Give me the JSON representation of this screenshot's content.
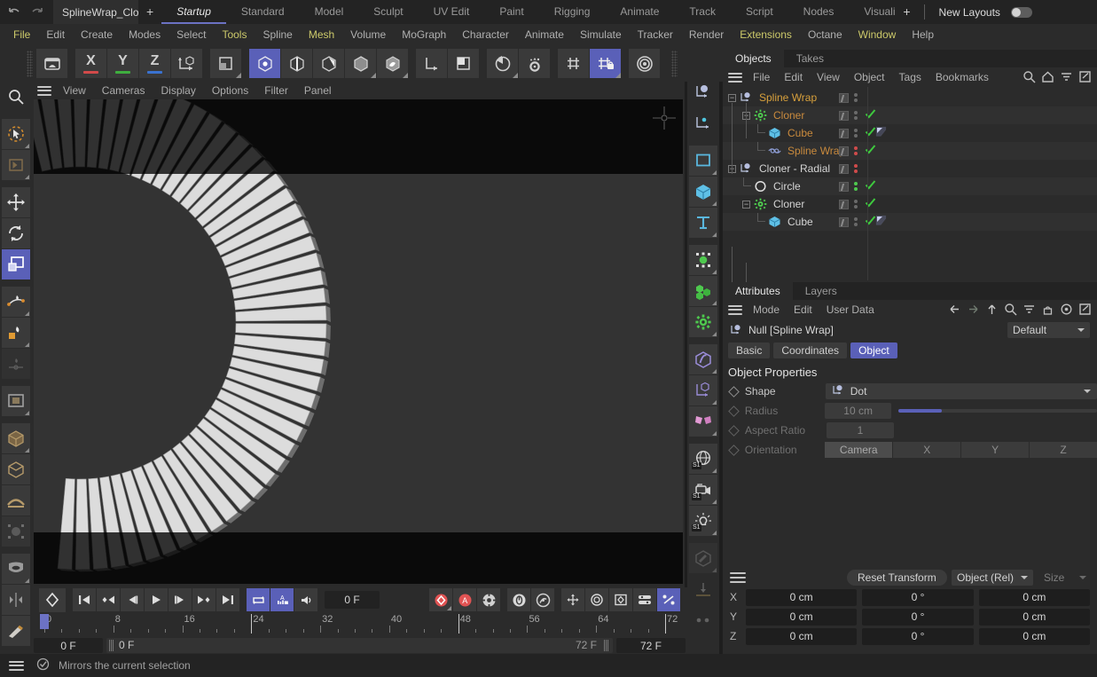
{
  "window": {
    "document_tab": "SplineWrap_Clon",
    "add_tab": "+",
    "new_layouts": "New Layouts"
  },
  "layout_tabs": [
    {
      "label": "Startup",
      "active": true
    },
    {
      "label": "Standard",
      "active": false
    },
    {
      "label": "Model",
      "active": false
    },
    {
      "label": "Sculpt",
      "active": false
    },
    {
      "label": "UV Edit",
      "active": false
    },
    {
      "label": "Paint",
      "active": false
    },
    {
      "label": "Rigging",
      "active": false
    },
    {
      "label": "Animate",
      "active": false
    },
    {
      "label": "Track",
      "active": false
    },
    {
      "label": "Script",
      "active": false
    },
    {
      "label": "Nodes",
      "active": false
    },
    {
      "label": "Visualiz",
      "active": false
    }
  ],
  "menubar": [
    {
      "label": "File",
      "highlight": true
    },
    {
      "label": "Edit",
      "highlight": false
    },
    {
      "label": "Create",
      "highlight": false
    },
    {
      "label": "Modes",
      "highlight": false
    },
    {
      "label": "Select",
      "highlight": false
    },
    {
      "label": "Tools",
      "highlight": true
    },
    {
      "label": "Spline",
      "highlight": false
    },
    {
      "label": "Mesh",
      "highlight": true
    },
    {
      "label": "Volume",
      "highlight": false
    },
    {
      "label": "MoGraph",
      "highlight": false
    },
    {
      "label": "Character",
      "highlight": false
    },
    {
      "label": "Animate",
      "highlight": false
    },
    {
      "label": "Simulate",
      "highlight": false
    },
    {
      "label": "Tracker",
      "highlight": false
    },
    {
      "label": "Render",
      "highlight": false
    },
    {
      "label": "Extensions",
      "highlight": true
    },
    {
      "label": "Octane",
      "highlight": false
    },
    {
      "label": "Window",
      "highlight": true
    },
    {
      "label": "Help",
      "highlight": false
    }
  ],
  "main_toolbar": {
    "axis_x": "X",
    "axis_y": "Y",
    "axis_z": "Z",
    "color_x": "#d24a4a",
    "color_y": "#3fae3f",
    "color_z": "#3a72d0",
    "accent": "#5a60b8"
  },
  "viewport": {
    "menu": [
      "View",
      "Cameras",
      "Display",
      "Options",
      "Filter",
      "Panel"
    ],
    "background": "#333333",
    "band_color": "#0a0a0a"
  },
  "object_manager": {
    "tabs": [
      {
        "label": "Objects",
        "active": true
      },
      {
        "label": "Takes",
        "active": false
      }
    ],
    "menu": [
      "File",
      "Edit",
      "View",
      "Object",
      "Tags",
      "Bookmarks"
    ],
    "tree": [
      {
        "name": "Spline Wrap",
        "depth": 0,
        "color": "#d7a03c",
        "icon": "null-object-icon",
        "expander": "-",
        "dots": "grey",
        "check": false,
        "tag": false,
        "alt": false
      },
      {
        "name": "Cloner",
        "depth": 1,
        "color": "#c98a3d",
        "icon": "cloner-icon",
        "expander": "-",
        "dots": "grey",
        "check": true,
        "tag": false,
        "alt": true
      },
      {
        "name": "Cube",
        "depth": 2,
        "color": "#c98a3d",
        "icon": "cube-icon",
        "expander": "",
        "dots": "grey",
        "check": true,
        "tag": true,
        "alt": false
      },
      {
        "name": "Spline Wrap",
        "depth": 2,
        "color": "#c98a3d",
        "icon": "spline-wrap-icon",
        "expander": "",
        "dots": "red",
        "check": true,
        "tag": false,
        "alt": true
      },
      {
        "name": "Cloner - Radial",
        "depth": 0,
        "color": "#d4d4d4",
        "icon": "null-object-icon",
        "expander": "-",
        "dots": "red",
        "check": false,
        "tag": false,
        "alt": false
      },
      {
        "name": "Circle",
        "depth": 1,
        "color": "#d4d4d4",
        "icon": "circle-spline-icon",
        "expander": "",
        "dots": "green",
        "check": true,
        "tag": false,
        "alt": true
      },
      {
        "name": "Cloner",
        "depth": 1,
        "color": "#d4d4d4",
        "icon": "cloner-icon",
        "expander": "-",
        "dots": "grey",
        "check": true,
        "tag": false,
        "alt": false
      },
      {
        "name": "Cube",
        "depth": 2,
        "color": "#d4d4d4",
        "icon": "cube-icon",
        "expander": "",
        "dots": "grey",
        "check": true,
        "tag": true,
        "alt": true
      }
    ]
  },
  "attributes": {
    "tabs": [
      {
        "label": "Attributes",
        "active": true
      },
      {
        "label": "Layers",
        "active": false
      }
    ],
    "menu": [
      "Mode",
      "Edit",
      "User Data"
    ],
    "object_title": "Null [Spline Wrap]",
    "preset": "Default",
    "mode_tabs": [
      {
        "label": "Basic",
        "active": false
      },
      {
        "label": "Coordinates",
        "active": false
      },
      {
        "label": "Object",
        "active": true
      }
    ],
    "section_title": "Object Properties",
    "properties": [
      {
        "label": "Shape",
        "type": "dropdown",
        "value": "Dot",
        "dim": false
      },
      {
        "label": "Radius",
        "type": "field-slider",
        "value": "10 cm",
        "slider_pct": 22,
        "dim": true
      },
      {
        "label": "Aspect Ratio",
        "type": "field",
        "value": "1",
        "dim": true
      },
      {
        "label": "Orientation",
        "type": "segmented",
        "value": "Camera",
        "options": [
          "Camera",
          "X",
          "Y",
          "Z"
        ],
        "dim": true
      }
    ]
  },
  "coordinates": {
    "reset_label": "Reset Transform",
    "mode": "Object (Rel)",
    "size_label": "Size",
    "rows": [
      {
        "axis": "X",
        "position": "0 cm",
        "rotation": "0 °",
        "size": "0 cm"
      },
      {
        "axis": "Y",
        "position": "0 cm",
        "rotation": "0 °",
        "size": "0 cm"
      },
      {
        "axis": "Z",
        "position": "0 cm",
        "rotation": "0 °",
        "size": "0 cm"
      }
    ]
  },
  "timeline": {
    "current_frame": "0 F",
    "start_frame": "0 F",
    "preview_from": "0 F",
    "preview_to": "72 F",
    "end_frame": "72 F",
    "ruler_labels": [
      "0",
      "8",
      "16",
      "24",
      "32",
      "40",
      "48",
      "56",
      "64",
      "72"
    ],
    "ruler_values": [
      0,
      8,
      16,
      24,
      32,
      40,
      48,
      56,
      64,
      72
    ],
    "playhead_frame": 0,
    "marker_frames": [
      24,
      48,
      72
    ]
  },
  "statusbar": {
    "message": "Mirrors the current selection"
  }
}
